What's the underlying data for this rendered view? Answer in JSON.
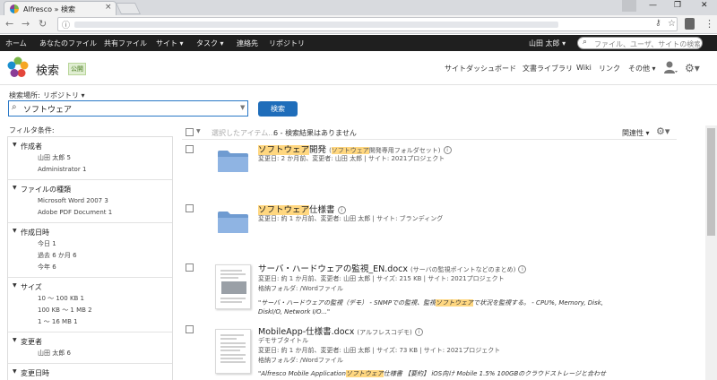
{
  "browser": {
    "tab_title": "Alfresco » 検索",
    "tab_close": "×",
    "window_controls": [
      "—",
      "❐",
      "✕"
    ]
  },
  "appnav": {
    "links": [
      "ホーム",
      "あなたのファイル",
      "共有ファイル"
    ],
    "dropdowns": [
      "サイト ▾",
      "タスク ▾"
    ],
    "links2": [
      "連絡先",
      "リポジトリ"
    ],
    "user": "山田 太郎 ▾",
    "search_placeholder": "ファイル、ユーザ、サイトの検索"
  },
  "site_header": {
    "title": "検索",
    "badge": "公開",
    "links": [
      "サイトダッシュボード",
      "文書ライブラリ",
      "Wiki",
      "リンク",
      "その他 ▾"
    ]
  },
  "search": {
    "scope_label": "検索場所:",
    "scope_value": "リポジトリ ▾",
    "query": "ソフトウェア",
    "button_label": "検索"
  },
  "filters": {
    "title": "フィルタ条件:",
    "groups": [
      {
        "title": "作成者",
        "items": [
          "山田 太郎  5",
          "Administrator  1"
        ]
      },
      {
        "title": "ファイルの種類",
        "items": [
          "Microsoft Word 2007  3",
          "Adobe PDF Document  1"
        ]
      },
      {
        "title": "作成日時",
        "items": [
          "今日  1",
          "過去 6 か月  6",
          "今年  6"
        ]
      },
      {
        "title": "サイズ",
        "items": [
          "10 ～ 100 KB  1",
          "100 KB ～ 1 MB  2",
          "1 ～ 16 MB  1"
        ]
      },
      {
        "title": "変更者",
        "items": [
          "山田 太郎  6"
        ]
      },
      {
        "title": "変更日時",
        "items": []
      }
    ]
  },
  "results_toolbar": {
    "selected_action": "選択したアイテム...",
    "count_text": "6 - 検索結果はありません",
    "sort_label": "関連性 ▾"
  },
  "results": [
    {
      "kind": "folder",
      "title_hl": "ソフトウェア",
      "title_rest": "開発",
      "subtitle_pre": "(",
      "subtitle_hl": "ソフトウェア",
      "subtitle_rest": "開発専用フォルダセット)",
      "meta": "変更日: 2 か月前、変更者: 山田 太郎 | サイト: 2021プロジェクト"
    },
    {
      "kind": "folder",
      "title_hl": "ソフトウェア",
      "title_rest": "仕様書",
      "meta": "変更日: 約 1 か月前、変更者: 山田 太郎 | サイト: ブランディング"
    },
    {
      "kind": "doc",
      "title_hl": "",
      "title_rest": "サーバ・ハードウェアの監視_EN.docx",
      "subtitle_rest": "(サーバの監視ポイントなどのまとめ)",
      "meta": "変更日: 約 1 か月前、変更者: 山田 太郎 | サイズ: 215 KB | サイト: 2021プロジェクト",
      "meta2": "格納フォルダ: /Wordファイル",
      "snippet_pre": "\"サーバ・ハードウェアの監視（デモ） - SNMPでの監視、監視",
      "snippet_hl": "ソフトウェア",
      "snippet_post": "で状況を監視する。 - CPU%, Memory, Disk,",
      "snippet2": "DiskI/O, Network I/O...\""
    },
    {
      "kind": "doc",
      "title_hl": "",
      "title_rest": "MobileApp-仕様書.docx",
      "subtitle_rest": "(アルフレスコデモ)",
      "meta0": "デモサブタイトル",
      "meta": "変更日: 約 1 か月前、変更者: 山田 太郎 | サイズ: 73 KB | サイト: 2021プロジェクト",
      "meta2": "格納フォルダ: /Wordファイル",
      "snippet_pre": "\"Alfresco Mobile Application",
      "snippet_hl": "ソフトウェア",
      "snippet_post": "仕様書 【要約】 iOS向け Mobile 1.5% 100GBのクラウドストレージと合わせ"
    }
  ],
  "colors": {
    "primary_button": "#1f6dba",
    "highlight": "#ffd780",
    "nav_bg": "#1f1f1f"
  }
}
